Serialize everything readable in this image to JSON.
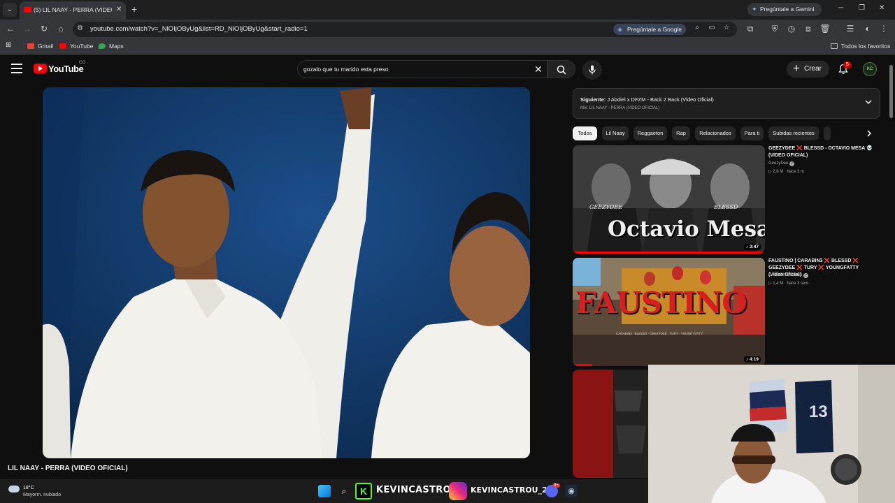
{
  "browser": {
    "tab_title": "(5) LIL NAAY - PERRA (VIDEO O",
    "gemini_button": "Pregúntale a Gemini",
    "url": "youtube.com/watch?v=_NlOIjOByUg&list=RD_NlOIjOByUg&start_radio=1",
    "omnibox_gemini": "Pregúntale a Google",
    "bookmarks": [
      "Gmail",
      "YouTube",
      "Maps"
    ],
    "all_bookmarks": "Todos los favoritos"
  },
  "youtube": {
    "wordmark": "YouTube",
    "country_code": "CO",
    "search_query": "gozalo que tu marido esta preso",
    "create_label": "Crear",
    "notification_count": "5",
    "video_title": "LIL NAAY - PERRA (VIDEO OFICIAL)",
    "up_next": {
      "prefix": "Siguiente:",
      "title": "J Abdiel x DFZM - Back 2 Back (Video Oficial)",
      "mix": "Mix: LIL NAAY - PERRA (VIDEO OFICIAL)"
    },
    "chips": [
      "Todos",
      "Lil Naay",
      "Reggaeton",
      "Rap",
      "Relacionados",
      "Para ti",
      "Subidas recientes"
    ],
    "recommendations": [
      {
        "title": "GEEZYDEE ❌ BLESSD - OCTAVIO MESA 💀 (VIDEO OFICIAL)",
        "channel": "GeezyDee",
        "views": "2,8 M",
        "age": "hace 3 m",
        "duration": "3:47",
        "thumb_text": "Octavio Mesa",
        "thumb_left": "GEEZYDEE",
        "thumb_right": "BLESSD",
        "progress": 1.0
      },
      {
        "title": "FAUSTINO | CARABIN3 ❌ BLESSD ❌ GEEZYDEE ❌ TURY ❌ YOUNGFATTY (Video Oficial)",
        "channel": "CARABIN3 Oficial",
        "views": "1,4 M",
        "age": "hace 3 sem.",
        "duration": "4:19",
        "thumb_text": "FAUSTINO",
        "thumb_sub": "CARABIN3 · BLESSD · GEEZYDEE · TURY · YOUNG FATTY",
        "progress": 0.1
      }
    ]
  },
  "taskbar": {
    "temperature": "18°C",
    "weather": "Mayorm. nublado",
    "kick_overlay": "KEVINCASTRO",
    "ig_overlay": "KEVINCASTROU_23",
    "discord_badge": "9+"
  },
  "colors": {
    "yt_red": "#ff0000",
    "background": "#0f0f0f",
    "chip_active": "#f1f1f1",
    "kick_green": "#53fc18"
  }
}
